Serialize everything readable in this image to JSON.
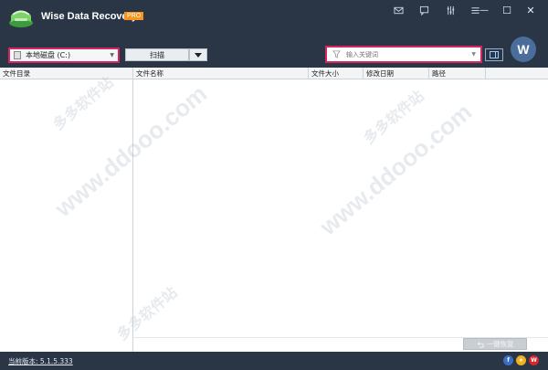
{
  "app": {
    "title": "Wise Data Recovery",
    "badge": "PRO"
  },
  "titlebar": {
    "icons": [
      "mail-icon",
      "comment-icon",
      "settings-sliders-icon",
      "menu-icon"
    ],
    "minimize": "—",
    "maximize": "☐",
    "close": "✕"
  },
  "toolbar": {
    "drive_value": "本地磁盘 (C:)",
    "scan_label": "扫描",
    "search_placeholder": "输入关键词",
    "avatar_letter": "W"
  },
  "table": {
    "left_header": "文件目录",
    "columns": [
      "文件名称",
      "文件大小",
      "修改日期",
      "路径"
    ]
  },
  "actions": {
    "recover_label": "一键恢复"
  },
  "status": {
    "version": "当前版本: 5.1.5.333"
  },
  "watermark": {
    "text": "www.ddooo.com",
    "brand": "多多软件站"
  },
  "colors": {
    "titlebar": "#2a3546",
    "highlight_border": "#d6245f",
    "badge": "#f7941d"
  }
}
